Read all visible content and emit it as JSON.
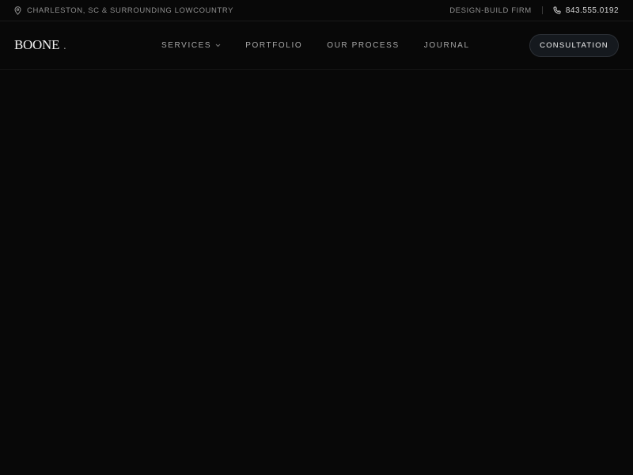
{
  "topbar": {
    "location_icon": "map-pin-icon",
    "location": "CHARLESTON, SC & SURROUNDING LOWCOUNTRY",
    "firm_type": "DESIGN-BUILD FIRM",
    "phone_icon": "phone-icon",
    "phone": "843.555.0192"
  },
  "header": {
    "logo": "BOONE",
    "logo_dot": "."
  },
  "nav": {
    "items": [
      {
        "label": "SERVICES",
        "has_dropdown": true
      },
      {
        "label": "PORTFOLIO"
      },
      {
        "label": "OUR PROCESS"
      },
      {
        "label": "JOURNAL"
      }
    ],
    "cta": "CONSULTATION"
  },
  "colors": {
    "background": "#080808",
    "cta_bg": "#15191e",
    "text_muted": "#8e8e8e"
  }
}
